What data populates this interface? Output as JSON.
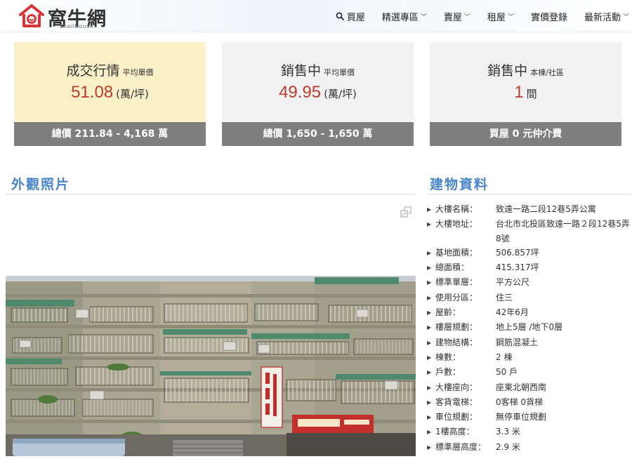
{
  "header": {
    "logo_text": "窩牛網",
    "logo_sub": "Snailhouse",
    "nav": [
      {
        "label": "買屋",
        "icon": "search-icon",
        "dropdown": false
      },
      {
        "label": "精選專區",
        "dropdown": true
      },
      {
        "label": "賣屋",
        "dropdown": true
      },
      {
        "label": "租屋",
        "dropdown": true
      },
      {
        "label": "實價登錄",
        "dropdown": false
      },
      {
        "label": "最新活動",
        "dropdown": true
      }
    ]
  },
  "cards": [
    {
      "title": "成交行情",
      "sub": "平均單價",
      "value": "51.08",
      "unit": "(萬/坪)",
      "footer": "總價 211.84 - 4,168 萬"
    },
    {
      "title": "銷售中",
      "sub": "平均單價",
      "value": "49.95",
      "unit": "(萬/坪)",
      "footer": "總價 1,650 - 1,650 萬"
    },
    {
      "title": "銷售中",
      "sub": "本棟/社區",
      "value": "1",
      "unit": "間",
      "footer": "買屋 0 元仲介費"
    }
  ],
  "photo_section": {
    "title": "外觀照片"
  },
  "info_section": {
    "title": "建物資料",
    "rows": [
      {
        "label": "大樓名稱：",
        "value": "致遠一路二段12巷5弄公寓"
      },
      {
        "label": "大樓地址：",
        "value": "台北市北投區致遠一路２段12巷5弄8號"
      },
      {
        "label": "基地面積：",
        "value": "506.857坪"
      },
      {
        "label": "總面積：",
        "value": "415.317坪"
      },
      {
        "label": "標準單層：",
        "value": "平方公尺"
      },
      {
        "label": "使用分區：",
        "value": "住三"
      },
      {
        "label": "屋齡：",
        "value": "42年6月"
      },
      {
        "label": "樓層規劃：",
        "value": "地上5層 /地下0層"
      },
      {
        "label": "建物結構：",
        "value": "鋼筋混凝土"
      },
      {
        "label": "棟數：",
        "value": "2 棟"
      },
      {
        "label": "戶數：",
        "value": "50 戶"
      },
      {
        "label": "大樓座向：",
        "value": "座東北朝西南"
      },
      {
        "label": "客貨電梯：",
        "value": "0客梯 0貨梯"
      },
      {
        "label": "車位規劃：",
        "value": "無停車位規劃"
      },
      {
        "label": "1樓高度：",
        "value": "3.3 米"
      },
      {
        "label": "標準層高度：",
        "value": "2.9 米"
      }
    ]
  },
  "colors": {
    "accent_blue": "#4a86c7",
    "price_red": "#c0392b",
    "highlight_bg": "#fbf1c8",
    "footer_gray": "#7f7f7f",
    "logo_red": "#d9343a"
  }
}
